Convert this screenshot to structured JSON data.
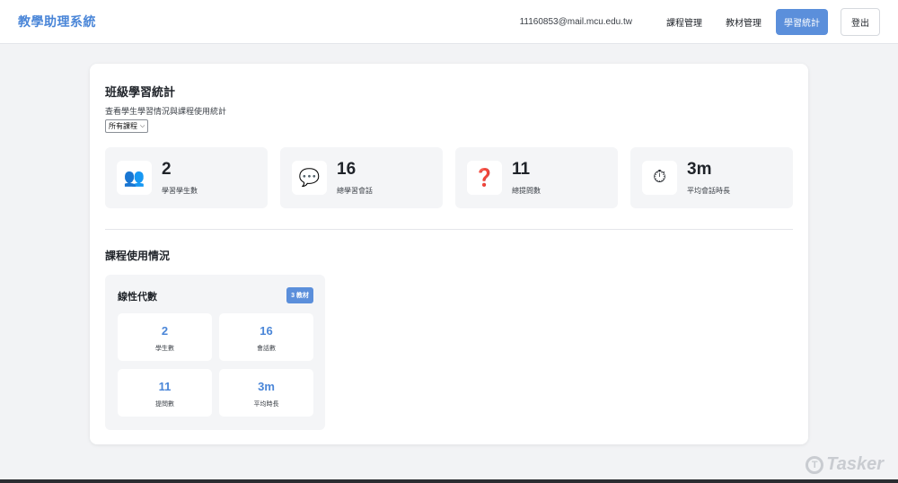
{
  "header": {
    "brand": "教學助理系統",
    "user_email": "11160853@mail.mcu.edu.tw",
    "nav": [
      {
        "label": "課程管理",
        "active": false
      },
      {
        "label": "教材管理",
        "active": false
      },
      {
        "label": "學習統計",
        "active": true
      }
    ],
    "logout_label": "登出"
  },
  "page": {
    "title": "班級學習統計",
    "subtitle": "查看學生學習情況與課程使用統計",
    "course_filter": {
      "selected": "所有課程"
    }
  },
  "stats": [
    {
      "icon": "students-icon",
      "glyph": "👥",
      "value": "2",
      "label": "學習學生數"
    },
    {
      "icon": "chat-icon",
      "glyph": "💬",
      "value": "16",
      "label": "總學習會話"
    },
    {
      "icon": "question-icon",
      "glyph": "❓",
      "value": "11",
      "label": "總提問數"
    },
    {
      "icon": "stopwatch-icon",
      "glyph": "⏱",
      "value": "3m",
      "label": "平均會話時長"
    }
  ],
  "usage": {
    "title": "課程使用情況",
    "courses": [
      {
        "name": "線性代數",
        "badge": "3 教材",
        "metrics": [
          {
            "value": "2",
            "label": "學生數"
          },
          {
            "value": "16",
            "label": "會話數"
          },
          {
            "value": "11",
            "label": "提問數"
          },
          {
            "value": "3m",
            "label": "平均時長"
          }
        ]
      }
    ]
  },
  "watermark": {
    "text": "Tasker"
  },
  "colors": {
    "accent": "#5b8fdb",
    "brand": "#4a86d8",
    "card_bg": "#f4f5f7",
    "page_bg": "#f2f3f5"
  }
}
